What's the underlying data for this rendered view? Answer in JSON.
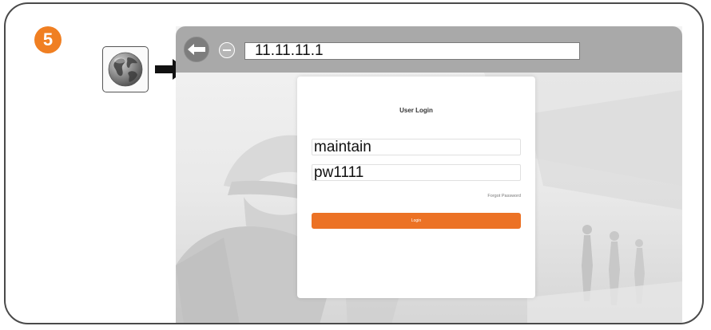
{
  "step": {
    "number": "5"
  },
  "browser": {
    "icon": "globe-icon",
    "url": "11.11.11.1"
  },
  "login": {
    "title": "User Login",
    "username_value": "maintain",
    "password_value": "pw1111",
    "forgot_label": "Forgot Password",
    "login_label": "Login"
  },
  "colors": {
    "accent": "#ec7225",
    "badge": "#f07f22",
    "address_bar": "#a9a9a9"
  }
}
